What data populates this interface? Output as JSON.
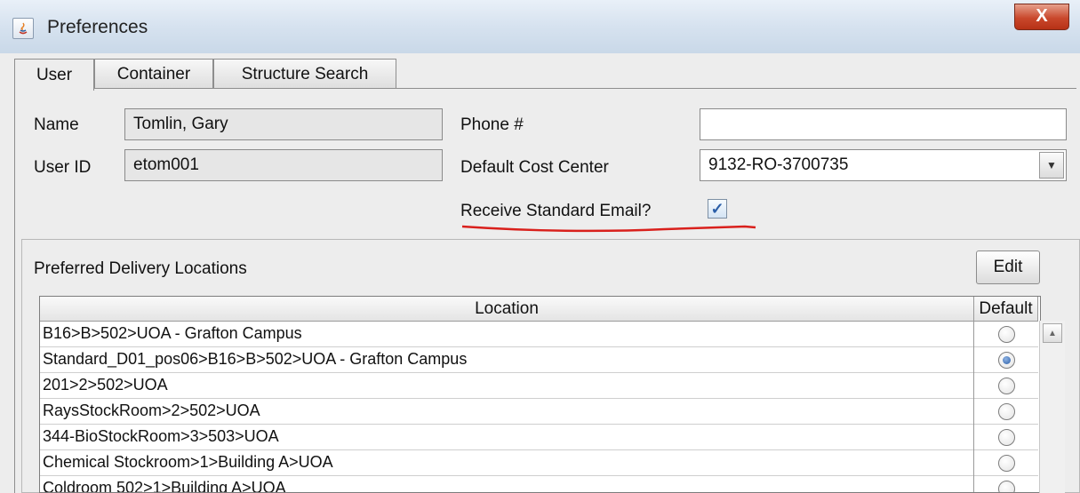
{
  "window": {
    "title": "Preferences",
    "close_label": "X"
  },
  "tabs": [
    {
      "label": "User",
      "active": true
    },
    {
      "label": "Container",
      "active": false
    },
    {
      "label": "Structure Search",
      "active": false
    }
  ],
  "user": {
    "name_label": "Name",
    "name_value": "Tomlin, Gary",
    "userid_label": "User ID",
    "userid_value": "etom001",
    "phone_label": "Phone #",
    "phone_value": "",
    "cost_center_label": "Default Cost Center",
    "cost_center_value": "9132-RO-3700735",
    "email_label": "Receive Standard Email?",
    "email_checked": true
  },
  "delivery": {
    "title": "Preferred Delivery Locations",
    "edit_label": "Edit",
    "columns": [
      "Location",
      "Default"
    ],
    "rows": [
      {
        "location": "B16>B>502>UOA - Grafton Campus",
        "default": false
      },
      {
        "location": "Standard_D01_pos06>B16>B>502>UOA - Grafton Campus",
        "default": true
      },
      {
        "location": "201>2>502>UOA",
        "default": false
      },
      {
        "location": "RaysStockRoom>2>502>UOA",
        "default": false
      },
      {
        "location": "344-BioStockRoom>3>503>UOA",
        "default": false
      },
      {
        "location": "Chemical Stockroom>1>Building A>UOA",
        "default": false
      },
      {
        "location": "Coldroom 502>1>Building A>UOA",
        "default": false
      }
    ]
  },
  "colors": {
    "annotation_underline": "#d9201c",
    "radio_selected": "#2a5ea8"
  }
}
